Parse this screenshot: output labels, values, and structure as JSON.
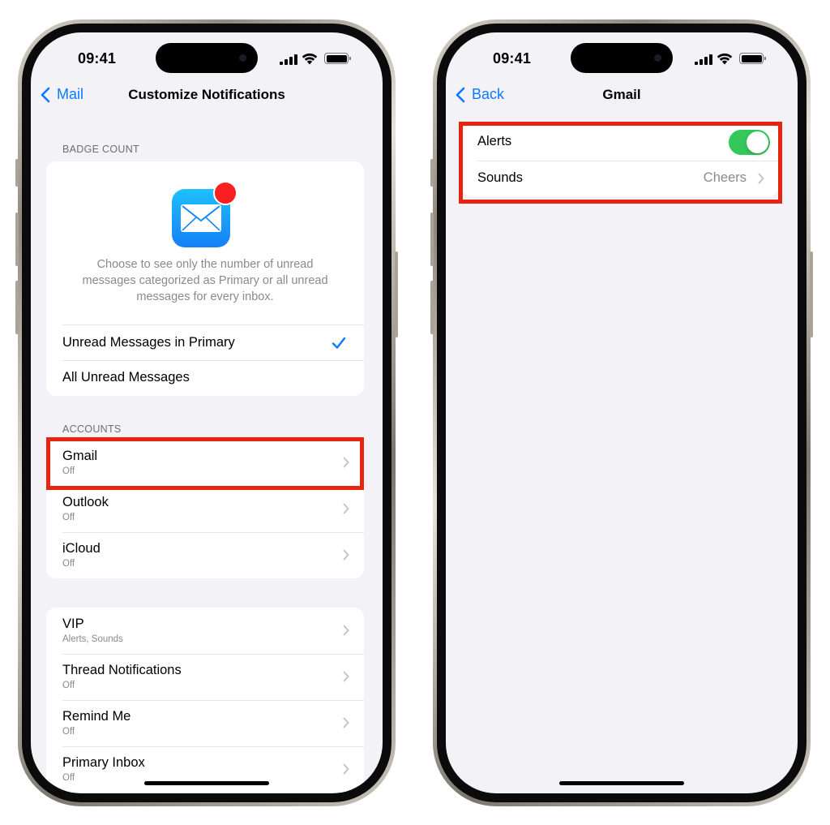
{
  "status_bar": {
    "time": "09:41"
  },
  "left_screen": {
    "nav": {
      "back_label": "Mail",
      "title": "Customize Notifications"
    },
    "badge_count": {
      "header": "BADGE COUNT",
      "description": "Choose to see only the number of unread messages categorized as Primary or all unread messages for every inbox.",
      "options": [
        {
          "label": "Unread Messages in Primary",
          "selected": true
        },
        {
          "label": "All Unread Messages",
          "selected": false
        }
      ]
    },
    "accounts": {
      "header": "ACCOUNTS",
      "items": [
        {
          "title": "Gmail",
          "subtitle": "Off"
        },
        {
          "title": "Outlook",
          "subtitle": "Off"
        },
        {
          "title": "iCloud",
          "subtitle": "Off"
        }
      ]
    },
    "other": {
      "items": [
        {
          "title": "VIP",
          "subtitle": "Alerts, Sounds"
        },
        {
          "title": "Thread Notifications",
          "subtitle": "Off"
        },
        {
          "title": "Remind Me",
          "subtitle": "Off"
        },
        {
          "title": "Primary Inbox",
          "subtitle": "Off"
        }
      ]
    }
  },
  "right_screen": {
    "nav": {
      "back_label": "Back",
      "title": "Gmail"
    },
    "settings": {
      "alerts_label": "Alerts",
      "alerts_on": true,
      "sounds_label": "Sounds",
      "sounds_value": "Cheers"
    }
  },
  "colors": {
    "accent_blue": "#0a7aff",
    "toggle_green": "#34c759",
    "highlight_red": "#e7240f",
    "badge_red": "#fc1f1f",
    "background": "#f2f2f7"
  },
  "icons": [
    "back-chevron-icon",
    "mail-app-icon",
    "checkmark-icon",
    "chevron-right-icon",
    "signal-icon",
    "wifi-icon",
    "battery-icon"
  ]
}
